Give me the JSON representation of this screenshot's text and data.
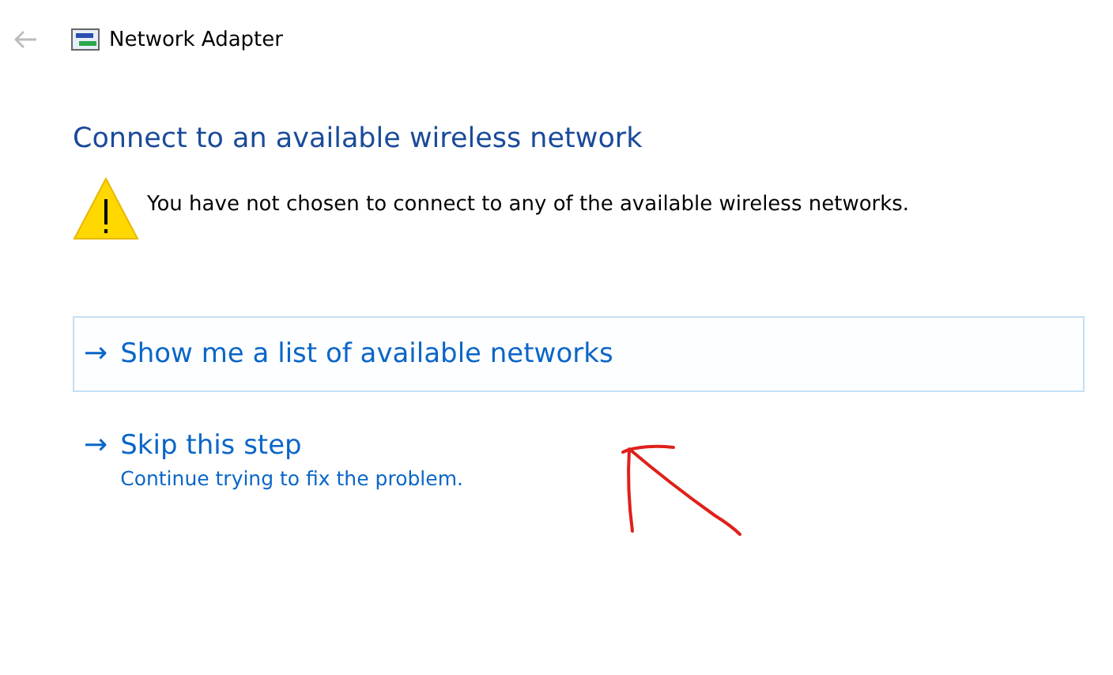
{
  "window": {
    "title": "Network Adapter"
  },
  "heading": "Connect to an available wireless network",
  "warning": {
    "message": "You have not chosen to connect to any of the available wireless networks."
  },
  "options": [
    {
      "arrow": "→",
      "label": "Show me a list of available networks",
      "selected": true
    },
    {
      "arrow": "→",
      "label": "Skip this step",
      "description": "Continue trying to fix the problem.",
      "selected": false
    }
  ]
}
